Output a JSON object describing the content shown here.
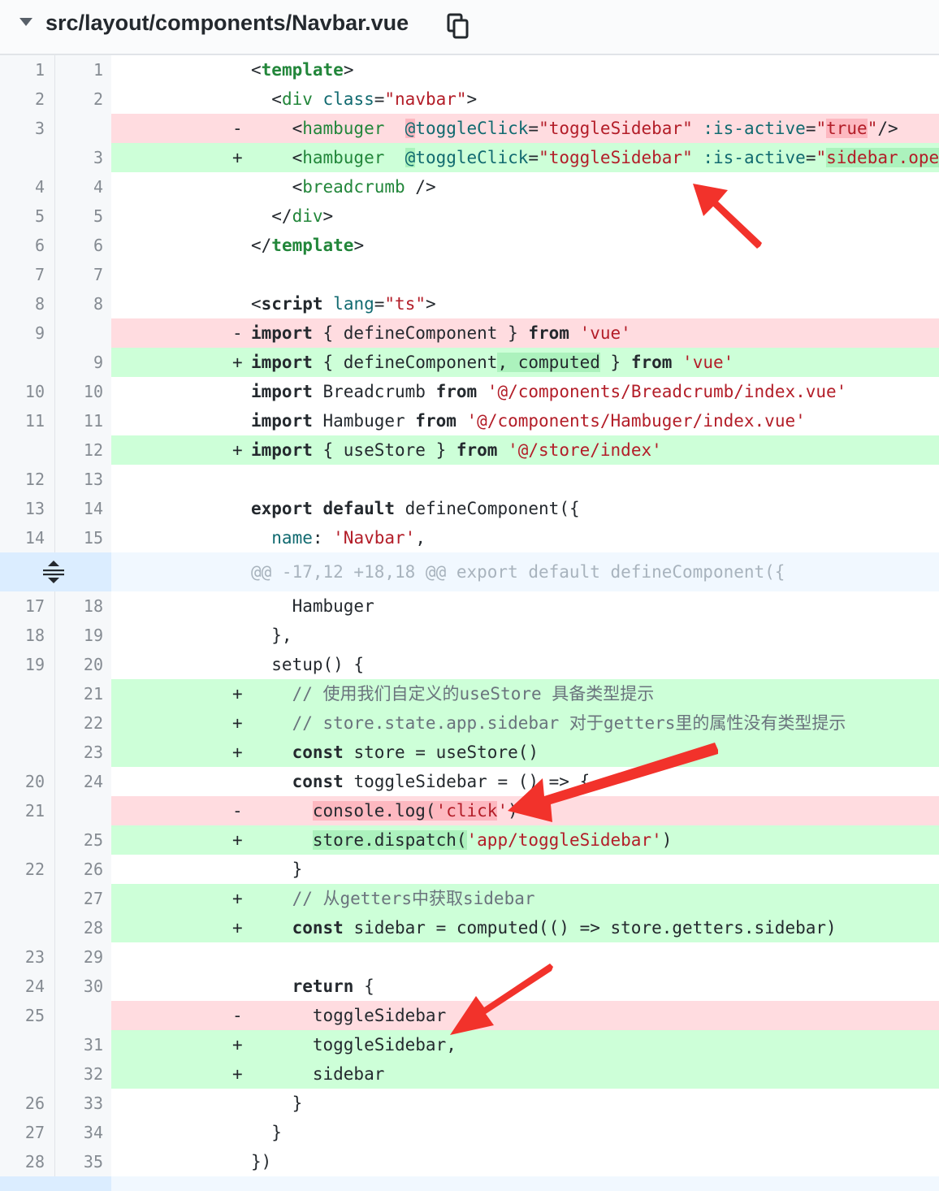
{
  "file": {
    "path": "src/layout/components/Navbar.vue",
    "copy_icon": "copy-icon",
    "collapse_icon": "caret-down-icon"
  },
  "lines": [
    {
      "type": "ctx",
      "old": "1",
      "new": "1",
      "sign": "",
      "tokens": [
        [
          "",
          "<"
        ],
        [
          "tag kw",
          "template"
        ],
        [
          "",
          ">"
        ]
      ]
    },
    {
      "type": "ctx",
      "old": "2",
      "new": "2",
      "sign": "",
      "tokens": [
        [
          "",
          "  <"
        ],
        [
          "tag",
          "div"
        ],
        [
          "attr",
          " class"
        ],
        [
          "",
          "="
        ],
        [
          "str",
          "\"navbar\""
        ],
        [
          "",
          ">"
        ]
      ]
    },
    {
      "type": "del",
      "old": "3",
      "new": "",
      "sign": "-",
      "tokens": [
        [
          "",
          "    <"
        ],
        [
          "tag",
          "hambuger"
        ],
        [
          "",
          "  "
        ],
        [
          "hl-del attr",
          "@"
        ],
        [
          "attr",
          "toggleClick"
        ],
        [
          "",
          "="
        ],
        [
          "str",
          "\"toggleSidebar\""
        ],
        [
          "",
          " "
        ],
        [
          "attr",
          ":is-active"
        ],
        [
          "",
          "="
        ],
        [
          "str",
          "\""
        ],
        [
          "str hl-del",
          "true"
        ],
        [
          "str",
          "\""
        ],
        [
          "",
          "/>"
        ]
      ]
    },
    {
      "type": "add",
      "old": "",
      "new": "3",
      "sign": "+",
      "tokens": [
        [
          "",
          "    <"
        ],
        [
          "tag",
          "hambuger"
        ],
        [
          "",
          "  "
        ],
        [
          "hl-add attr",
          "@"
        ],
        [
          "attr",
          "toggleClick"
        ],
        [
          "",
          "="
        ],
        [
          "str",
          "\"toggleSidebar\""
        ],
        [
          "",
          " "
        ],
        [
          "attr",
          ":is-active"
        ],
        [
          "",
          "="
        ],
        [
          "str",
          "\""
        ],
        [
          "str hl-add",
          "sidebar.opened"
        ],
        [
          "str",
          "\""
        ],
        [
          "",
          "/>"
        ]
      ]
    },
    {
      "type": "ctx",
      "old": "4",
      "new": "4",
      "sign": "",
      "tokens": [
        [
          "",
          "    <"
        ],
        [
          "tag",
          "breadcrumb"
        ],
        [
          "",
          " />"
        ]
      ]
    },
    {
      "type": "ctx",
      "old": "5",
      "new": "5",
      "sign": "",
      "tokens": [
        [
          "",
          "  </"
        ],
        [
          "tag",
          "div"
        ],
        [
          "",
          ">"
        ]
      ]
    },
    {
      "type": "ctx",
      "old": "6",
      "new": "6",
      "sign": "",
      "tokens": [
        [
          "",
          "</"
        ],
        [
          "tag kw",
          "template"
        ],
        [
          "",
          ">"
        ]
      ]
    },
    {
      "type": "ctx",
      "old": "7",
      "new": "7",
      "sign": "",
      "tokens": [
        [
          "",
          ""
        ]
      ]
    },
    {
      "type": "ctx",
      "old": "8",
      "new": "8",
      "sign": "",
      "tokens": [
        [
          "",
          "<"
        ],
        [
          "kw",
          "script"
        ],
        [
          "",
          " "
        ],
        [
          "attr",
          "lang"
        ],
        [
          "",
          "="
        ],
        [
          "str",
          "\"ts\""
        ],
        [
          "",
          ">"
        ]
      ]
    },
    {
      "type": "del",
      "old": "9",
      "new": "",
      "sign": "-",
      "tokens": [
        [
          "kw",
          "import"
        ],
        [
          "",
          " { defineComponent } "
        ],
        [
          "kw",
          "from"
        ],
        [
          "",
          " "
        ],
        [
          "str",
          "'vue'"
        ]
      ]
    },
    {
      "type": "add",
      "old": "",
      "new": "9",
      "sign": "+",
      "tokens": [
        [
          "kw",
          "import"
        ],
        [
          "",
          " { defineComponent"
        ],
        [
          "hl-add",
          ", computed"
        ],
        [
          "",
          " } "
        ],
        [
          "kw",
          "from"
        ],
        [
          "",
          " "
        ],
        [
          "str",
          "'vue'"
        ]
      ]
    },
    {
      "type": "ctx",
      "old": "10",
      "new": "10",
      "sign": "",
      "tokens": [
        [
          "kw",
          "import"
        ],
        [
          "",
          " Breadcrumb "
        ],
        [
          "kw",
          "from"
        ],
        [
          "",
          " "
        ],
        [
          "str",
          "'@/components/Breadcrumb/index.vue'"
        ]
      ]
    },
    {
      "type": "ctx",
      "old": "11",
      "new": "11",
      "sign": "",
      "tokens": [
        [
          "kw",
          "import"
        ],
        [
          "",
          " Hambuger "
        ],
        [
          "kw",
          "from"
        ],
        [
          "",
          " "
        ],
        [
          "str",
          "'@/components/Hambuger/index.vue'"
        ]
      ]
    },
    {
      "type": "add",
      "old": "",
      "new": "12",
      "sign": "+",
      "tokens": [
        [
          "kw",
          "import"
        ],
        [
          "",
          " { useStore } "
        ],
        [
          "kw",
          "from"
        ],
        [
          "",
          " "
        ],
        [
          "str",
          "'@/store/index'"
        ]
      ]
    },
    {
      "type": "ctx",
      "old": "12",
      "new": "13",
      "sign": "",
      "tokens": [
        [
          "",
          ""
        ]
      ]
    },
    {
      "type": "ctx",
      "old": "13",
      "new": "14",
      "sign": "",
      "tokens": [
        [
          "kw",
          "export"
        ],
        [
          "",
          " "
        ],
        [
          "kw",
          "default"
        ],
        [
          "",
          " defineComponent({"
        ]
      ]
    },
    {
      "type": "ctx",
      "old": "14",
      "new": "15",
      "sign": "",
      "tokens": [
        [
          "attr",
          "  name"
        ],
        [
          "",
          ": "
        ],
        [
          "str",
          "'Navbar'"
        ],
        [
          "",
          ","
        ]
      ]
    },
    {
      "type": "hunk",
      "old": "",
      "new": "",
      "sign": "",
      "tokens": [
        [
          "",
          "@@ -17,12 +18,18 @@ export default defineComponent({"
        ]
      ]
    },
    {
      "type": "ctx",
      "old": "17",
      "new": "18",
      "sign": "",
      "tokens": [
        [
          "",
          "    Hambuger"
        ]
      ]
    },
    {
      "type": "ctx",
      "old": "18",
      "new": "19",
      "sign": "",
      "tokens": [
        [
          "",
          "  },"
        ]
      ]
    },
    {
      "type": "ctx",
      "old": "19",
      "new": "20",
      "sign": "",
      "tokens": [
        [
          "",
          "  setup() {"
        ]
      ]
    },
    {
      "type": "add",
      "old": "",
      "new": "21",
      "sign": "+",
      "tokens": [
        [
          "cmt",
          "    // 使用我们自定义的useStore 具备类型提示"
        ]
      ]
    },
    {
      "type": "add",
      "old": "",
      "new": "22",
      "sign": "+",
      "tokens": [
        [
          "cmt",
          "    // store.state.app.sidebar 对于getters里的属性没有类型提示"
        ]
      ]
    },
    {
      "type": "add",
      "old": "",
      "new": "23",
      "sign": "+",
      "tokens": [
        [
          "",
          "    "
        ],
        [
          "kw",
          "const"
        ],
        [
          "",
          " store = useStore()"
        ]
      ]
    },
    {
      "type": "ctx",
      "old": "20",
      "new": "24",
      "sign": "",
      "tokens": [
        [
          "",
          "    "
        ],
        [
          "kw",
          "const"
        ],
        [
          "",
          " toggleSidebar = () => {"
        ]
      ]
    },
    {
      "type": "del",
      "old": "21",
      "new": "",
      "sign": "-",
      "tokens": [
        [
          "",
          "      "
        ],
        [
          "hl-del",
          "console.log("
        ],
        [
          "str hl-del",
          "'click"
        ],
        [
          "str",
          "'"
        ],
        [
          "",
          ")"
        ]
      ]
    },
    {
      "type": "add",
      "old": "",
      "new": "25",
      "sign": "+",
      "tokens": [
        [
          "",
          "      "
        ],
        [
          "hl-add",
          "store.dispatch("
        ],
        [
          "str",
          "'app/toggleSidebar"
        ],
        [
          "str hl-add",
          ""
        ],
        [
          "str",
          "'"
        ],
        [
          "",
          ")"
        ]
      ]
    },
    {
      "type": "ctx",
      "old": "22",
      "new": "26",
      "sign": "",
      "tokens": [
        [
          "",
          "    }"
        ]
      ]
    },
    {
      "type": "add",
      "old": "",
      "new": "27",
      "sign": "+",
      "tokens": [
        [
          "cmt",
          "    // 从getters中获取sidebar"
        ]
      ]
    },
    {
      "type": "add",
      "old": "",
      "new": "28",
      "sign": "+",
      "tokens": [
        [
          "",
          "    "
        ],
        [
          "kw",
          "const"
        ],
        [
          "",
          " sidebar = computed(() => store.getters.sidebar)"
        ]
      ]
    },
    {
      "type": "ctx",
      "old": "23",
      "new": "29",
      "sign": "",
      "tokens": [
        [
          "",
          ""
        ]
      ]
    },
    {
      "type": "ctx",
      "old": "24",
      "new": "30",
      "sign": "",
      "tokens": [
        [
          "",
          "    "
        ],
        [
          "kw",
          "return"
        ],
        [
          "",
          " {"
        ]
      ]
    },
    {
      "type": "del",
      "old": "25",
      "new": "",
      "sign": "-",
      "tokens": [
        [
          "",
          "      toggleSidebar"
        ]
      ]
    },
    {
      "type": "add",
      "old": "",
      "new": "31",
      "sign": "+",
      "tokens": [
        [
          "",
          "      toggleSidebar,"
        ]
      ]
    },
    {
      "type": "add",
      "old": "",
      "new": "32",
      "sign": "+",
      "tokens": [
        [
          "",
          "      sidebar"
        ]
      ]
    },
    {
      "type": "ctx",
      "old": "26",
      "new": "33",
      "sign": "",
      "tokens": [
        [
          "",
          "    }"
        ]
      ]
    },
    {
      "type": "ctx",
      "old": "27",
      "new": "34",
      "sign": "",
      "tokens": [
        [
          "",
          "  }"
        ]
      ]
    },
    {
      "type": "ctx",
      "old": "28",
      "new": "35",
      "sign": "",
      "tokens": [
        [
          "",
          "})"
        ]
      ]
    },
    {
      "type": "end",
      "old": "",
      "new": "",
      "sign": "",
      "tokens": [
        [
          "",
          ""
        ]
      ]
    }
  ],
  "colors": {
    "arrow": "#f2322b",
    "add_bg": "#cdffd8",
    "del_bg": "#ffdce0",
    "hunk_bg": "#f1f8ff"
  }
}
